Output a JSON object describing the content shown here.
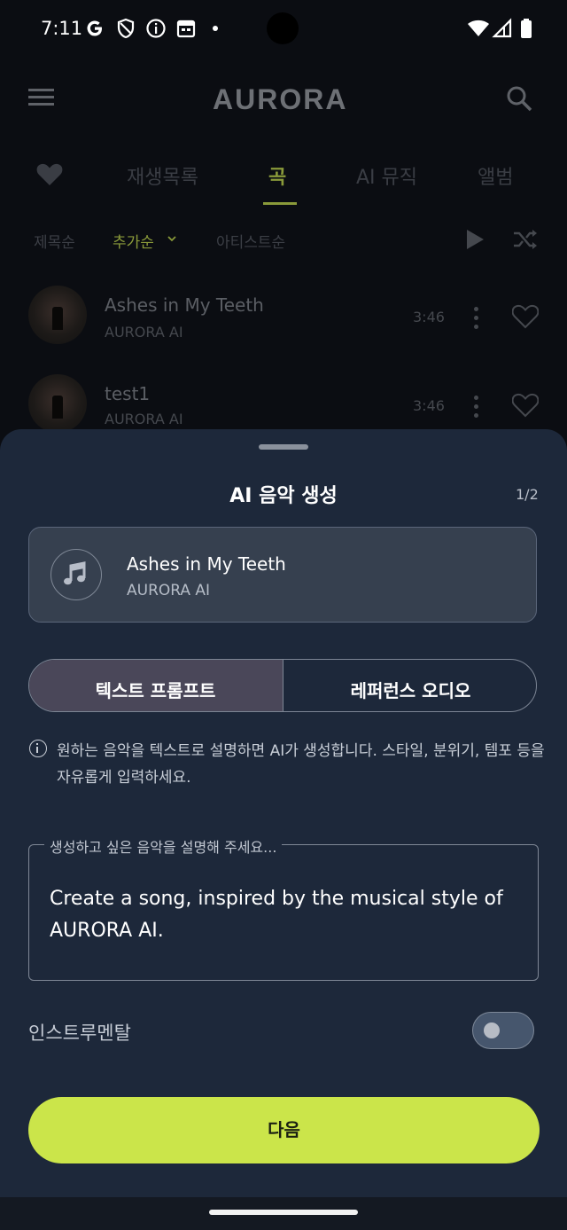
{
  "status_bar": {
    "time": "7:11"
  },
  "app": {
    "brand": "AURORA",
    "tabs": [
      {
        "label": "재생목록"
      },
      {
        "label": "곡"
      },
      {
        "label": "AI 뮤직"
      },
      {
        "label": "앨범"
      }
    ],
    "sort_options": [
      {
        "label": "제목순"
      },
      {
        "label": "추가순"
      },
      {
        "label": "아티스트순"
      }
    ],
    "songs": [
      {
        "title": "Ashes in My Teeth",
        "artist": "AURORA AI",
        "duration": "3:46"
      },
      {
        "title": "test1",
        "artist": "AURORA AI",
        "duration": "3:46"
      }
    ]
  },
  "sheet": {
    "title": "AI 음악 생성",
    "step": "1/2",
    "selected_song": {
      "title": "Ashes in My Teeth",
      "artist": "AURORA AI"
    },
    "segments": {
      "text_prompt": "텍스트 프롬프트",
      "reference_audio": "레퍼런스 오디오",
      "selected": "text_prompt"
    },
    "info_text": "원하는 음악을 텍스트로 설명하면 AI가 생성합니다. 스타일, 분위기, 템포 등을 자유롭게 입력하세요.",
    "prompt": {
      "label": "생성하고 싶은 음악을 설명해 주세요...",
      "value": "Create a song, inspired by the musical style of AURORA AI."
    },
    "instrumental": {
      "label": "인스트루멘탈",
      "enabled": false
    },
    "next_button": "다음"
  },
  "colors": {
    "accent": "#cbe54a",
    "sheet_bg": "#1d283a",
    "segment_selected": "#4a4759"
  }
}
